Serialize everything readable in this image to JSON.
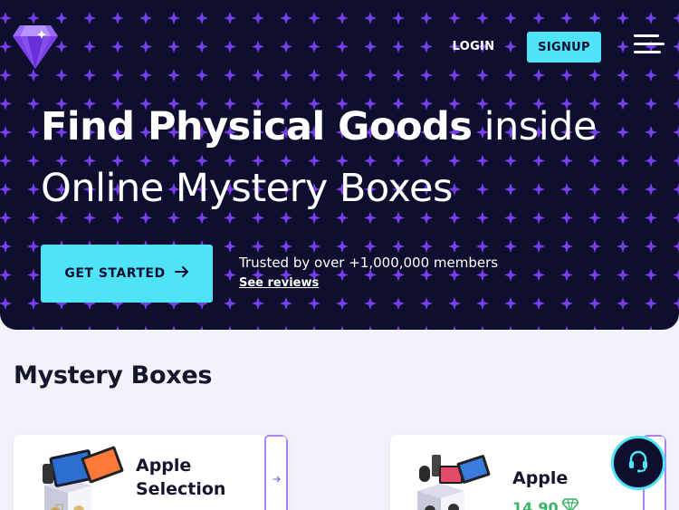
{
  "header": {
    "logo_icon": "gem-icon",
    "login_label": "LOGIN",
    "signup_label": "SIGNUP",
    "menu_icon": "hamburger-menu-icon"
  },
  "hero": {
    "headline_bold": "Find Physical Goods",
    "headline_rest_line1": " inside",
    "headline_line2": "Online Mystery Boxes",
    "cta_label": "GET STARTED",
    "cta_icon": "arrow-right-icon",
    "trust_text": "Trusted by over +1,000,000 members",
    "reviews_link": "See reviews",
    "pattern_icon": "sparkle-icon"
  },
  "mystery_boxes": {
    "title": "Mystery Boxes",
    "boxes": [
      {
        "name_line1": "Apple",
        "name_line2": "Selection",
        "price": "",
        "image_icon": "apple-products-box-image",
        "arrow_icon": "arrow-right-icon"
      },
      {
        "name_line1": "Apple",
        "name_line2": "",
        "price": "14.90",
        "price_icon": "gem-icon",
        "image_icon": "apple-products-box-image",
        "arrow_icon": "arrow-right-icon"
      }
    ]
  },
  "support": {
    "icon": "headset-icon"
  },
  "colors": {
    "hero_bg": "#0e0f2e",
    "accent": "#4ee3f6",
    "sparkle": "#7a3df0",
    "page_bg": "#f3f2fa",
    "price": "#3ab36a"
  }
}
